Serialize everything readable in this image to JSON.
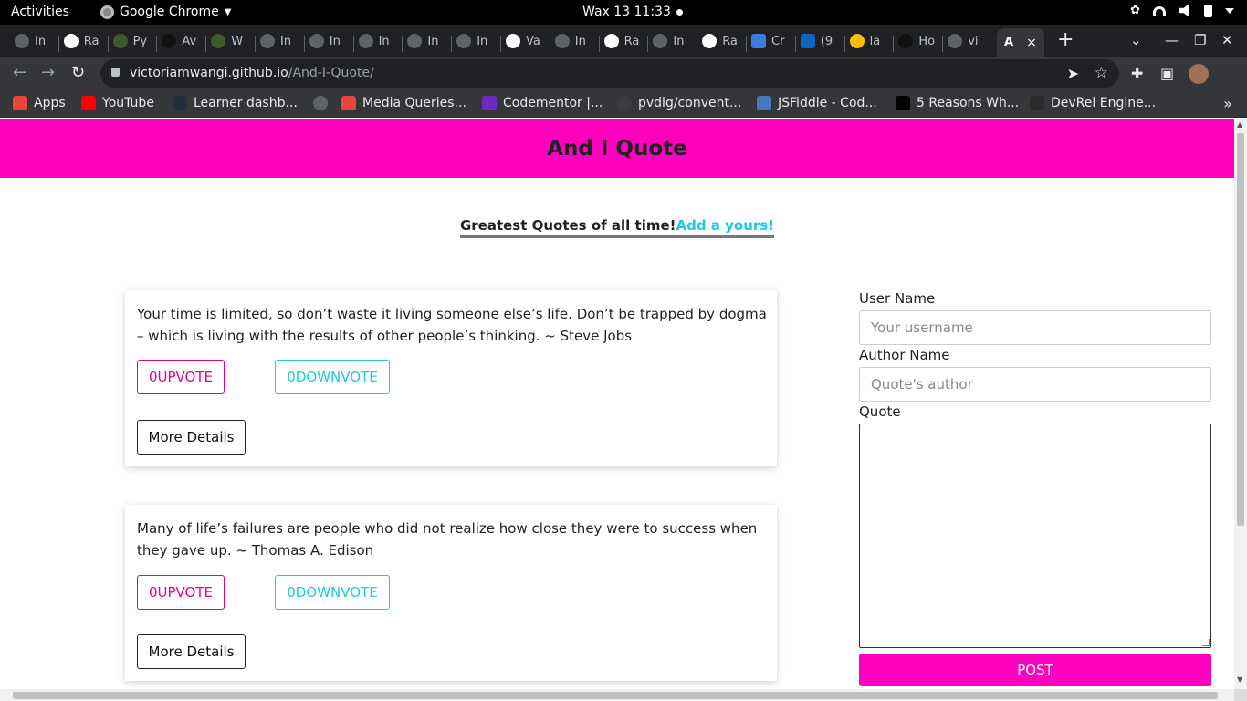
{
  "system_bar": {
    "activities": "Activities",
    "app_name": "Google Chrome",
    "clock": "Wax 13  11:33"
  },
  "tabs": [
    {
      "label": "In",
      "icon": "github-icon"
    },
    {
      "label": "Ra",
      "icon": "globe-icon"
    },
    {
      "label": "Py",
      "icon": "palm-icon"
    },
    {
      "label": "Av",
      "icon": "dark-icon"
    },
    {
      "label": "W",
      "icon": "palm-icon"
    },
    {
      "label": "In",
      "icon": "github-icon"
    },
    {
      "label": "In",
      "icon": "github-icon"
    },
    {
      "label": "In",
      "icon": "github-icon"
    },
    {
      "label": "In",
      "icon": "github-icon"
    },
    {
      "label": "In",
      "icon": "github-icon"
    },
    {
      "label": "Va",
      "icon": "globe-icon"
    },
    {
      "label": "In",
      "icon": "github-icon"
    },
    {
      "label": "Ra",
      "icon": "globe-icon"
    },
    {
      "label": "In",
      "icon": "github-icon"
    },
    {
      "label": "Ra",
      "icon": "globe-icon"
    },
    {
      "label": "Cr",
      "icon": "copy-icon"
    },
    {
      "label": "(9",
      "icon": "linkedin-icon"
    },
    {
      "label": "la",
      "icon": "google-icon"
    },
    {
      "label": "Ho",
      "icon": "dark-icon"
    },
    {
      "label": "vi",
      "icon": "github-icon"
    }
  ],
  "active_tab": {
    "label": "A",
    "close": "×"
  },
  "address_bar": {
    "domain": "victoriamwangi.github.io",
    "path": "/And-I-Quote/"
  },
  "bookmarks": [
    {
      "label": "Apps",
      "icon": "apps-grid-icon",
      "color": "#e8453c"
    },
    {
      "label": "YouTube",
      "icon": "youtube-icon",
      "color": "#ff0000"
    },
    {
      "label": "Learner dashb...",
      "icon": "aws-icon",
      "color": "#232f3e"
    },
    {
      "label": "",
      "icon": "globe-icon",
      "color": "#5f6368"
    },
    {
      "label": "Media Queries...",
      "icon": "asterisk-icon",
      "color": "#e8453c"
    },
    {
      "label": "Codementor |...",
      "icon": "codementor-icon",
      "color": "#6a2bc2"
    },
    {
      "label": "pvdlg/convent...",
      "icon": "github-icon",
      "color": "#3c3c3c"
    },
    {
      "label": "JSFiddle - Cod...",
      "icon": "jsfiddle-icon",
      "color": "#4679bd"
    },
    {
      "label": "5 Reasons Wh...",
      "icon": "f-icon",
      "color": "#000000"
    },
    {
      "label": "DevRel Engine...",
      "icon": "devrel-icon",
      "color": "#2b2b2b"
    }
  ],
  "page": {
    "title": "And I Quote",
    "tagline_part1": "Greatest Quotes of all time!",
    "tagline_link": "Add a yours!",
    "quotes": [
      {
        "text": "Your time is limited, so don’t waste it living someone else’s life. Don’t be trapped by dogma – which is living with the results of other people’s thinking. ~ Steve Jobs",
        "upvote": "0UPVOTE",
        "downvote": "0DOWNVOTE",
        "details": "More Details"
      },
      {
        "text": "Many of life’s failures are people who did not realize how close they were to success when they gave up. ~ Thomas A. Edison",
        "upvote": "0UPVOTE",
        "downvote": "0DOWNVOTE",
        "details": "More Details"
      }
    ],
    "form": {
      "username_label": "User Name",
      "username_placeholder": "Your username",
      "author_label": "Author Name",
      "author_placeholder": "Quote's author",
      "quote_label": "Quote",
      "post_button": "POST"
    }
  },
  "colors": {
    "brand_pink": "#ff00bf",
    "accent_cyan": "#22c8e0"
  }
}
